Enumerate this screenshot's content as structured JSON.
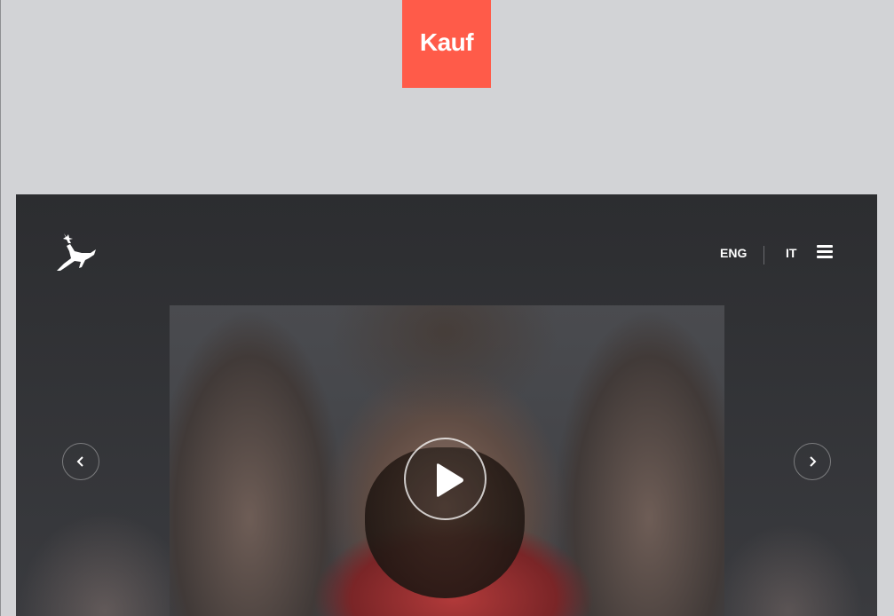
{
  "brand": {
    "badge_text": "Kauf",
    "badge_color": "#ff5b49"
  },
  "hero": {
    "logo_icon": "deer-leaping-icon",
    "languages": [
      "ENG",
      "IT"
    ],
    "menu_icon": "hamburger-menu-icon",
    "play_icon": "play-icon",
    "prev_icon": "chevron-left-icon",
    "next_icon": "chevron-right-icon",
    "background_color": "#2f3033"
  },
  "page": {
    "background_color": "#d2d3d6"
  }
}
